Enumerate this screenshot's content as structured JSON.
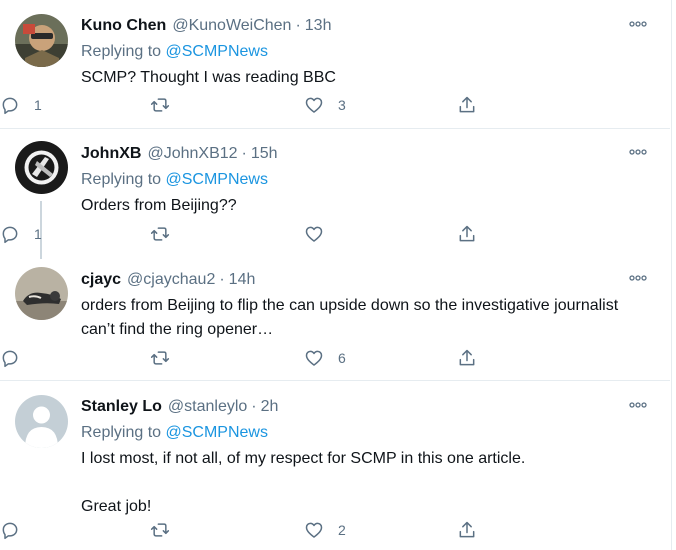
{
  "tweets": [
    {
      "name": "Kuno Chen",
      "handle": "@KunoWeiChen",
      "dot": "·",
      "time": "13h",
      "replying_prefix": "Replying to ",
      "replying_to": "@SCMPNews",
      "text": "SCMP? Thought I was reading BBC",
      "replies": "1",
      "retweets": "",
      "likes": "3"
    },
    {
      "name": "JohnXB",
      "handle": "@JohnXB12",
      "dot": "·",
      "time": "15h",
      "replying_prefix": "Replying to ",
      "replying_to": "@SCMPNews",
      "text": "Orders from Beijing??",
      "replies": "1",
      "retweets": "",
      "likes": ""
    },
    {
      "name": "cjayc",
      "handle": "@cjaychau2",
      "dot": "·",
      "time": "14h",
      "text": "orders from Beijing to flip the can upside down so the investigative journalist can’t find the ring opener…",
      "replies": "",
      "retweets": "",
      "likes": "6"
    },
    {
      "name": "Stanley Lo",
      "handle": "@stanleylo",
      "dot": "·",
      "time": "2h",
      "replying_prefix": "Replying to ",
      "replying_to": "@SCMPNews",
      "text": "I lost most, if not all, of my respect for SCMP in this one article.\n\nGreat job!",
      "replies": "",
      "retweets": "",
      "likes": "2"
    }
  ],
  "icons": {
    "more": "more-icon",
    "reply": "reply-icon",
    "retweet": "retweet-icon",
    "like": "like-icon",
    "share": "share-icon"
  },
  "colors": {
    "link": "#1b95e0",
    "secondary_text": "#5b7083",
    "divider": "#e6ecf0"
  }
}
